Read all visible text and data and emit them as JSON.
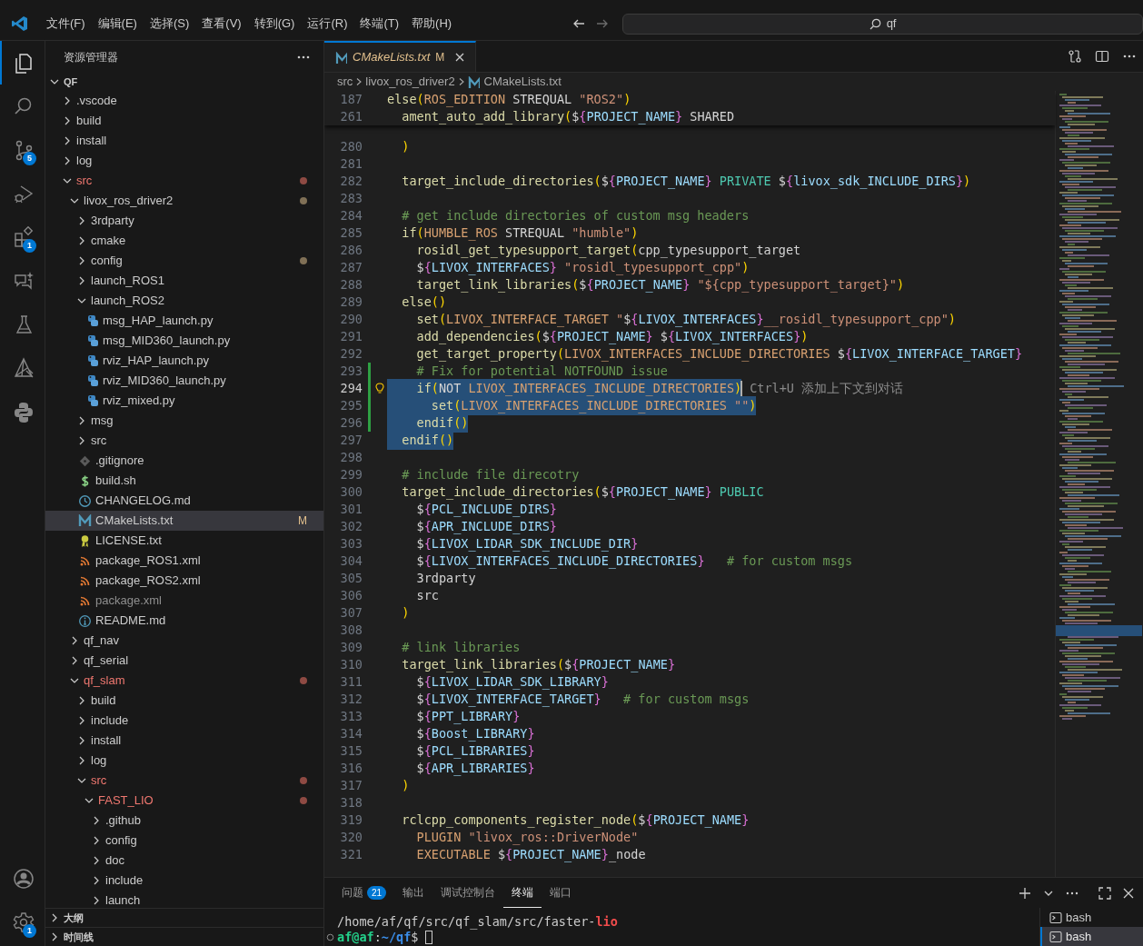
{
  "title_bar": {
    "menus": [
      "文件(F)",
      "编辑(E)",
      "选择(S)",
      "查看(V)",
      "转到(G)",
      "运行(R)",
      "终端(T)",
      "帮助(H)"
    ],
    "command_center": {
      "label": "qf"
    }
  },
  "activity_bar": {
    "top": [
      {
        "kind": "files",
        "selected": true
      },
      {
        "kind": "search",
        "selected": false
      },
      {
        "kind": "source_control",
        "selected": false,
        "badge": "5"
      },
      {
        "kind": "debug",
        "selected": false
      },
      {
        "kind": "extensions",
        "selected": false,
        "badge": "1"
      },
      {
        "kind": "chat",
        "selected": false
      },
      {
        "kind": "testing",
        "selected": false
      },
      {
        "kind": "cmake",
        "selected": false
      },
      {
        "kind": "python",
        "selected": false
      }
    ],
    "bottom": [
      {
        "kind": "account",
        "selected": false
      },
      {
        "kind": "settings",
        "selected": false,
        "badge": "1"
      }
    ]
  },
  "sidebar": {
    "title": "资源管理器",
    "root": {
      "label": "QF",
      "expanded": true
    },
    "tree": [
      {
        "label": ".vscode",
        "kind": "folder",
        "expanded": false,
        "selected": false,
        "problems": false,
        "changed": false,
        "ignored": false
      },
      {
        "label": "build",
        "kind": "folder",
        "expanded": false,
        "selected": false,
        "problems": false,
        "changed": false,
        "ignored": false
      },
      {
        "label": "install",
        "kind": "folder",
        "expanded": false,
        "selected": false,
        "problems": false,
        "changed": false,
        "ignored": false
      },
      {
        "label": "log",
        "kind": "folder",
        "expanded": false,
        "selected": false,
        "problems": false,
        "changed": false,
        "ignored": false
      },
      {
        "label": "src",
        "kind": "folder",
        "expanded": true,
        "selected": false,
        "problems": true,
        "changed": false,
        "ignored": false,
        "children": [
          {
            "label": "livox_ros_driver2",
            "kind": "folder",
            "expanded": true,
            "selected": false,
            "problems": false,
            "changed": true,
            "ignored": false,
            "children": [
              {
                "label": "3rdparty",
                "kind": "folder",
                "expanded": false,
                "selected": false,
                "problems": false,
                "changed": false,
                "ignored": false
              },
              {
                "label": "cmake",
                "kind": "folder",
                "expanded": false,
                "selected": false,
                "problems": false,
                "changed": false,
                "ignored": false
              },
              {
                "label": "config",
                "kind": "folder",
                "expanded": false,
                "selected": false,
                "problems": false,
                "changed": true,
                "ignored": false
              },
              {
                "label": "launch_ROS1",
                "kind": "folder",
                "expanded": false,
                "selected": false,
                "problems": false,
                "changed": false,
                "ignored": false
              },
              {
                "label": "launch_ROS2",
                "kind": "folder",
                "expanded": true,
                "selected": false,
                "problems": false,
                "changed": false,
                "ignored": false,
                "children": [
                  {
                    "label": "msg_HAP_launch.py",
                    "kind": "python",
                    "selected": false,
                    "problems": false,
                    "changed": false,
                    "ignored": false
                  },
                  {
                    "label": "msg_MID360_launch.py",
                    "kind": "python",
                    "selected": false,
                    "problems": false,
                    "changed": false,
                    "ignored": false
                  },
                  {
                    "label": "rviz_HAP_launch.py",
                    "kind": "python",
                    "selected": false,
                    "problems": false,
                    "changed": false,
                    "ignored": false
                  },
                  {
                    "label": "rviz_MID360_launch.py",
                    "kind": "python",
                    "selected": false,
                    "problems": false,
                    "changed": false,
                    "ignored": false
                  },
                  {
                    "label": "rviz_mixed.py",
                    "kind": "python",
                    "selected": false,
                    "problems": false,
                    "changed": false,
                    "ignored": false
                  }
                ]
              },
              {
                "label": "msg",
                "kind": "folder",
                "expanded": false,
                "selected": false,
                "problems": false,
                "changed": false,
                "ignored": false
              },
              {
                "label": "src",
                "kind": "folder",
                "expanded": false,
                "selected": false,
                "problems": false,
                "changed": false,
                "ignored": false
              },
              {
                "label": ".gitignore",
                "kind": "git",
                "selected": false,
                "problems": false,
                "changed": false,
                "ignored": false
              },
              {
                "label": "build.sh",
                "kind": "shell",
                "selected": false,
                "problems": false,
                "changed": false,
                "ignored": false
              },
              {
                "label": "CHANGELOG.md",
                "kind": "history",
                "selected": false,
                "problems": false,
                "changed": false,
                "ignored": false
              },
              {
                "label": "CMakeLists.txt",
                "kind": "cmake",
                "selected": true,
                "problems": false,
                "changed": false,
                "ignored": false,
                "badge": "M"
              },
              {
                "label": "LICENSE.txt",
                "kind": "license",
                "selected": false,
                "problems": false,
                "changed": false,
                "ignored": false
              },
              {
                "label": "package_ROS1.xml",
                "kind": "feed",
                "selected": false,
                "problems": false,
                "changed": false,
                "ignored": false
              },
              {
                "label": "package_ROS2.xml",
                "kind": "feed",
                "selected": false,
                "problems": false,
                "changed": false,
                "ignored": false
              },
              {
                "label": "package.xml",
                "kind": "feed",
                "selected": false,
                "problems": false,
                "changed": false,
                "ignored": true
              },
              {
                "label": "README.md",
                "kind": "info",
                "selected": false,
                "problems": false,
                "changed": false,
                "ignored": false
              }
            ]
          },
          {
            "label": "qf_nav",
            "kind": "folder",
            "expanded": false,
            "selected": false,
            "problems": false,
            "changed": false,
            "ignored": false
          },
          {
            "label": "qf_serial",
            "kind": "folder",
            "expanded": false,
            "selected": false,
            "problems": false,
            "changed": false,
            "ignored": false
          },
          {
            "label": "qf_slam",
            "kind": "folder",
            "expanded": true,
            "selected": false,
            "problems": true,
            "changed": false,
            "ignored": false,
            "children": [
              {
                "label": "build",
                "kind": "folder",
                "expanded": false,
                "selected": false,
                "problems": false,
                "changed": false,
                "ignored": false
              },
              {
                "label": "include",
                "kind": "folder",
                "expanded": false,
                "selected": false,
                "problems": false,
                "changed": false,
                "ignored": false
              },
              {
                "label": "install",
                "kind": "folder",
                "expanded": false,
                "selected": false,
                "problems": false,
                "changed": false,
                "ignored": false
              },
              {
                "label": "log",
                "kind": "folder",
                "expanded": false,
                "selected": false,
                "problems": false,
                "changed": false,
                "ignored": false
              },
              {
                "label": "src",
                "kind": "folder",
                "expanded": true,
                "selected": false,
                "problems": true,
                "changed": false,
                "ignored": false,
                "children": [
                  {
                    "label": "FAST_LIO",
                    "kind": "folder",
                    "expanded": true,
                    "selected": false,
                    "problems": true,
                    "changed": false,
                    "ignored": false,
                    "children": [
                      {
                        "label": ".github",
                        "kind": "folder",
                        "expanded": false,
                        "selected": false,
                        "problems": false,
                        "changed": false,
                        "ignored": false
                      },
                      {
                        "label": "config",
                        "kind": "folder",
                        "expanded": false,
                        "selected": false,
                        "problems": false,
                        "changed": false,
                        "ignored": false
                      },
                      {
                        "label": "doc",
                        "kind": "folder",
                        "expanded": false,
                        "selected": false,
                        "problems": false,
                        "changed": false,
                        "ignored": false
                      },
                      {
                        "label": "include",
                        "kind": "folder",
                        "expanded": false,
                        "selected": false,
                        "problems": false,
                        "changed": false,
                        "ignored": false
                      },
                      {
                        "label": "launch",
                        "kind": "folder",
                        "expanded": false,
                        "selected": false,
                        "problems": false,
                        "changed": false,
                        "ignored": false
                      }
                    ]
                  }
                ]
              }
            ]
          }
        ]
      }
    ],
    "sections": [
      {
        "label": "大纲",
        "expanded": false
      },
      {
        "label": "时间线",
        "expanded": false
      }
    ]
  },
  "editor": {
    "tabs": [
      {
        "label": "CMakeLists.txt",
        "badge": "M",
        "selected": true,
        "preview": true
      }
    ],
    "breadcrumbs": [
      {
        "label": "src",
        "kind": "folder"
      },
      {
        "label": "livox_ros_driver2",
        "kind": "folder"
      },
      {
        "label": "CMakeLists.txt",
        "kind": "cmake"
      }
    ],
    "sticky_lines": [
      {
        "number": "187",
        "tokens": [
          {
            "text": "else",
            "kind": "function"
          },
          {
            "text": "(",
            "kind": "paren"
          },
          {
            "text": "ROS_EDITION",
            "kind": "constant"
          },
          {
            "text": " STREQUAL ",
            "kind": "plain"
          },
          {
            "text": "\"ROS2\"",
            "kind": "string"
          },
          {
            "text": ")",
            "kind": "paren"
          }
        ]
      },
      {
        "number": "261",
        "tokens": [
          {
            "text": "  ament_auto_add_library",
            "kind": "function"
          },
          {
            "text": "(",
            "kind": "paren"
          },
          {
            "text": "$",
            "kind": "plain"
          },
          {
            "text": "{",
            "kind": "brace"
          },
          {
            "text": "PROJECT_NAME",
            "kind": "variable"
          },
          {
            "text": "}",
            "kind": "brace"
          },
          {
            "text": " SHARED",
            "kind": "plain"
          }
        ]
      }
    ],
    "lines": [
      {
        "number": "280",
        "current": false,
        "selected": false,
        "changed": false,
        "tokens": [
          {
            "text": "  )",
            "kind": "paren"
          }
        ]
      },
      {
        "number": "281",
        "current": false,
        "selected": false,
        "changed": false
      },
      {
        "number": "282",
        "current": false,
        "selected": false,
        "changed": false,
        "tokens": [
          {
            "text": "  target_include_directories",
            "kind": "function"
          },
          {
            "text": "(",
            "kind": "paren"
          },
          {
            "text": "$",
            "kind": "plain"
          },
          {
            "text": "{",
            "kind": "brace"
          },
          {
            "text": "PROJECT_NAME",
            "kind": "variable"
          },
          {
            "text": "}",
            "kind": "brace"
          },
          {
            "text": " PRIVATE",
            "kind": "keyword"
          },
          {
            "text": " $",
            "kind": "plain"
          },
          {
            "text": "{",
            "kind": "brace"
          },
          {
            "text": "livox_sdk_INCLUDE_DIRS",
            "kind": "variable"
          },
          {
            "text": "}",
            "kind": "brace"
          },
          {
            "text": ")",
            "kind": "paren"
          }
        ]
      },
      {
        "number": "283",
        "current": false,
        "selected": false,
        "changed": false
      },
      {
        "number": "284",
        "current": false,
        "selected": false,
        "changed": false,
        "tokens": [
          {
            "text": "  # get include directories of custom msg headers",
            "kind": "comment"
          }
        ]
      },
      {
        "number": "285",
        "current": false,
        "selected": false,
        "changed": false,
        "tokens": [
          {
            "text": "  if",
            "kind": "function"
          },
          {
            "text": "(",
            "kind": "paren"
          },
          {
            "text": "HUMBLE_ROS",
            "kind": "constant"
          },
          {
            "text": " STREQUAL ",
            "kind": "plain"
          },
          {
            "text": "\"humble\"",
            "kind": "string"
          },
          {
            "text": ")",
            "kind": "paren"
          }
        ]
      },
      {
        "number": "286",
        "current": false,
        "selected": false,
        "changed": false,
        "tokens": [
          {
            "text": "    rosidl_get_typesupport_target",
            "kind": "function"
          },
          {
            "text": "(",
            "kind": "paren"
          },
          {
            "text": "cpp_typesupport_target",
            "kind": "plain"
          }
        ]
      },
      {
        "number": "287",
        "current": false,
        "selected": false,
        "changed": false,
        "tokens": [
          {
            "text": "    $",
            "kind": "plain"
          },
          {
            "text": "{",
            "kind": "brace"
          },
          {
            "text": "LIVOX_INTERFACES",
            "kind": "variable"
          },
          {
            "text": "}",
            "kind": "brace"
          },
          {
            "text": " \"rosidl_typesupport_cpp\"",
            "kind": "string"
          },
          {
            "text": ")",
            "kind": "paren"
          }
        ]
      },
      {
        "number": "288",
        "current": false,
        "selected": false,
        "changed": false,
        "tokens": [
          {
            "text": "    target_link_libraries",
            "kind": "function"
          },
          {
            "text": "(",
            "kind": "paren"
          },
          {
            "text": "$",
            "kind": "plain"
          },
          {
            "text": "{",
            "kind": "brace"
          },
          {
            "text": "PROJECT_NAME",
            "kind": "variable"
          },
          {
            "text": "}",
            "kind": "brace"
          },
          {
            "text": " \"${cpp_typesupport_target}\"",
            "kind": "string"
          },
          {
            "text": ")",
            "kind": "paren"
          }
        ]
      },
      {
        "number": "289",
        "current": false,
        "selected": false,
        "changed": false,
        "tokens": [
          {
            "text": "  else",
            "kind": "function"
          },
          {
            "text": "()",
            "kind": "paren"
          }
        ]
      },
      {
        "number": "290",
        "current": false,
        "selected": false,
        "changed": false,
        "tokens": [
          {
            "text": "    set",
            "kind": "function"
          },
          {
            "text": "(",
            "kind": "paren"
          },
          {
            "text": "LIVOX_INTERFACE_TARGET",
            "kind": "constant"
          },
          {
            "text": " \"",
            "kind": "string"
          },
          {
            "text": "$",
            "kind": "plain"
          },
          {
            "text": "{",
            "kind": "brace"
          },
          {
            "text": "LIVOX_INTERFACES",
            "kind": "variable"
          },
          {
            "text": "}",
            "kind": "brace"
          },
          {
            "text": "__rosidl_typesupport_cpp\"",
            "kind": "string"
          },
          {
            "text": ")",
            "kind": "paren"
          }
        ]
      },
      {
        "number": "291",
        "current": false,
        "selected": false,
        "changed": false,
        "tokens": [
          {
            "text": "    add_dependencies",
            "kind": "function"
          },
          {
            "text": "(",
            "kind": "paren"
          },
          {
            "text": "$",
            "kind": "plain"
          },
          {
            "text": "{",
            "kind": "brace"
          },
          {
            "text": "PROJECT_NAME",
            "kind": "variable"
          },
          {
            "text": "}",
            "kind": "brace"
          },
          {
            "text": " $",
            "kind": "plain"
          },
          {
            "text": "{",
            "kind": "brace"
          },
          {
            "text": "LIVOX_INTERFACES",
            "kind": "variable"
          },
          {
            "text": "}",
            "kind": "brace"
          },
          {
            "text": ")",
            "kind": "paren"
          }
        ]
      },
      {
        "number": "292",
        "current": false,
        "selected": false,
        "changed": false,
        "tokens": [
          {
            "text": "    get_target_property",
            "kind": "function"
          },
          {
            "text": "(",
            "kind": "paren"
          },
          {
            "text": "LIVOX_INTERFACES_INCLUDE_DIRECTORIES",
            "kind": "constant"
          },
          {
            "text": " $",
            "kind": "plain"
          },
          {
            "text": "{",
            "kind": "brace"
          },
          {
            "text": "LIVOX_INTERFACE_TARGET",
            "kind": "variable"
          },
          {
            "text": "}",
            "kind": "brace"
          }
        ]
      },
      {
        "number": "293",
        "current": false,
        "selected": false,
        "changed": true,
        "tokens": [
          {
            "text": "    # Fix for potential NOTFOUND issue",
            "kind": "comment"
          }
        ]
      },
      {
        "number": "294",
        "current": true,
        "selected": true,
        "changed": true,
        "hint": "Ctrl+U 添加上下文到对话",
        "tokens": [
          {
            "text": "    if",
            "kind": "function"
          },
          {
            "text": "(",
            "kind": "paren"
          },
          {
            "text": "NOT ",
            "kind": "plain"
          },
          {
            "text": "LIVOX_INTERFACES_INCLUDE_DIRECTORIES",
            "kind": "constant"
          },
          {
            "text": ")",
            "kind": "paren"
          }
        ]
      },
      {
        "number": "295",
        "current": false,
        "selected": true,
        "changed": true,
        "tokens": [
          {
            "text": "      set",
            "kind": "function"
          },
          {
            "text": "(",
            "kind": "paren"
          },
          {
            "text": "LIVOX_INTERFACES_INCLUDE_DIRECTORIES",
            "kind": "constant"
          },
          {
            "text": " \"\"",
            "kind": "string"
          },
          {
            "text": ")",
            "kind": "paren"
          }
        ]
      },
      {
        "number": "296",
        "current": false,
        "selected": true,
        "changed": true,
        "tokens": [
          {
            "text": "    endif",
            "kind": "function"
          },
          {
            "text": "()",
            "kind": "paren"
          }
        ]
      },
      {
        "number": "297",
        "current": false,
        "selected": true,
        "changed": false,
        "tokens": [
          {
            "text": "  endif",
            "kind": "function"
          },
          {
            "text": "()",
            "kind": "paren"
          }
        ]
      },
      {
        "number": "298",
        "current": false,
        "selected": false,
        "changed": false
      },
      {
        "number": "299",
        "current": false,
        "selected": false,
        "changed": false,
        "tokens": [
          {
            "text": "  # include file direcotry",
            "kind": "comment"
          }
        ]
      },
      {
        "number": "300",
        "current": false,
        "selected": false,
        "changed": false,
        "tokens": [
          {
            "text": "  target_include_directories",
            "kind": "function"
          },
          {
            "text": "(",
            "kind": "paren"
          },
          {
            "text": "$",
            "kind": "plain"
          },
          {
            "text": "{",
            "kind": "brace"
          },
          {
            "text": "PROJECT_NAME",
            "kind": "variable"
          },
          {
            "text": "}",
            "kind": "brace"
          },
          {
            "text": " PUBLIC",
            "kind": "keyword"
          }
        ]
      },
      {
        "number": "301",
        "current": false,
        "selected": false,
        "changed": false,
        "tokens": [
          {
            "text": "    $",
            "kind": "plain"
          },
          {
            "text": "{",
            "kind": "brace"
          },
          {
            "text": "PCL_INCLUDE_DIRS",
            "kind": "variable"
          },
          {
            "text": "}",
            "kind": "brace"
          }
        ]
      },
      {
        "number": "302",
        "current": false,
        "selected": false,
        "changed": false,
        "tokens": [
          {
            "text": "    $",
            "kind": "plain"
          },
          {
            "text": "{",
            "kind": "brace"
          },
          {
            "text": "APR_INCLUDE_DIRS",
            "kind": "variable"
          },
          {
            "text": "}",
            "kind": "brace"
          }
        ]
      },
      {
        "number": "303",
        "current": false,
        "selected": false,
        "changed": false,
        "tokens": [
          {
            "text": "    $",
            "kind": "plain"
          },
          {
            "text": "{",
            "kind": "brace"
          },
          {
            "text": "LIVOX_LIDAR_SDK_INCLUDE_DIR",
            "kind": "variable"
          },
          {
            "text": "}",
            "kind": "brace"
          }
        ]
      },
      {
        "number": "304",
        "current": false,
        "selected": false,
        "changed": false,
        "tokens": [
          {
            "text": "    $",
            "kind": "plain"
          },
          {
            "text": "{",
            "kind": "brace"
          },
          {
            "text": "LIVOX_INTERFACES_INCLUDE_DIRECTORIES",
            "kind": "variable"
          },
          {
            "text": "}",
            "kind": "brace"
          },
          {
            "text": "   # for custom msgs",
            "kind": "comment"
          }
        ]
      },
      {
        "number": "305",
        "current": false,
        "selected": false,
        "changed": false,
        "tokens": [
          {
            "text": "    3rdparty",
            "kind": "plain"
          }
        ]
      },
      {
        "number": "306",
        "current": false,
        "selected": false,
        "changed": false,
        "tokens": [
          {
            "text": "    src",
            "kind": "plain"
          }
        ]
      },
      {
        "number": "307",
        "current": false,
        "selected": false,
        "changed": false,
        "tokens": [
          {
            "text": "  )",
            "kind": "paren"
          }
        ]
      },
      {
        "number": "308",
        "current": false,
        "selected": false,
        "changed": false
      },
      {
        "number": "309",
        "current": false,
        "selected": false,
        "changed": false,
        "tokens": [
          {
            "text": "  # link libraries",
            "kind": "comment"
          }
        ]
      },
      {
        "number": "310",
        "current": false,
        "selected": false,
        "changed": false,
        "tokens": [
          {
            "text": "  target_link_libraries",
            "kind": "function"
          },
          {
            "text": "(",
            "kind": "paren"
          },
          {
            "text": "$",
            "kind": "plain"
          },
          {
            "text": "{",
            "kind": "brace"
          },
          {
            "text": "PROJECT_NAME",
            "kind": "variable"
          },
          {
            "text": "}",
            "kind": "brace"
          }
        ]
      },
      {
        "number": "311",
        "current": false,
        "selected": false,
        "changed": false,
        "tokens": [
          {
            "text": "    $",
            "kind": "plain"
          },
          {
            "text": "{",
            "kind": "brace"
          },
          {
            "text": "LIVOX_LIDAR_SDK_LIBRARY",
            "kind": "variable"
          },
          {
            "text": "}",
            "kind": "brace"
          }
        ]
      },
      {
        "number": "312",
        "current": false,
        "selected": false,
        "changed": false,
        "tokens": [
          {
            "text": "    $",
            "kind": "plain"
          },
          {
            "text": "{",
            "kind": "brace"
          },
          {
            "text": "LIVOX_INTERFACE_TARGET",
            "kind": "variable"
          },
          {
            "text": "}",
            "kind": "brace"
          },
          {
            "text": "   # for custom msgs",
            "kind": "comment"
          }
        ]
      },
      {
        "number": "313",
        "current": false,
        "selected": false,
        "changed": false,
        "tokens": [
          {
            "text": "    $",
            "kind": "plain"
          },
          {
            "text": "{",
            "kind": "brace"
          },
          {
            "text": "PPT_LIBRARY",
            "kind": "variable"
          },
          {
            "text": "}",
            "kind": "brace"
          }
        ]
      },
      {
        "number": "314",
        "current": false,
        "selected": false,
        "changed": false,
        "tokens": [
          {
            "text": "    $",
            "kind": "plain"
          },
          {
            "text": "{",
            "kind": "brace"
          },
          {
            "text": "Boost_LIBRARY",
            "kind": "variable"
          },
          {
            "text": "}",
            "kind": "brace"
          }
        ]
      },
      {
        "number": "315",
        "current": false,
        "selected": false,
        "changed": false,
        "tokens": [
          {
            "text": "    $",
            "kind": "plain"
          },
          {
            "text": "{",
            "kind": "brace"
          },
          {
            "text": "PCL_LIBRARIES",
            "kind": "variable"
          },
          {
            "text": "}",
            "kind": "brace"
          }
        ]
      },
      {
        "number": "316",
        "current": false,
        "selected": false,
        "changed": false,
        "tokens": [
          {
            "text": "    $",
            "kind": "plain"
          },
          {
            "text": "{",
            "kind": "brace"
          },
          {
            "text": "APR_LIBRARIES",
            "kind": "variable"
          },
          {
            "text": "}",
            "kind": "brace"
          }
        ]
      },
      {
        "number": "317",
        "current": false,
        "selected": false,
        "changed": false,
        "tokens": [
          {
            "text": "  )",
            "kind": "paren"
          }
        ]
      },
      {
        "number": "318",
        "current": false,
        "selected": false,
        "changed": false
      },
      {
        "number": "319",
        "current": false,
        "selected": false,
        "changed": false,
        "tokens": [
          {
            "text": "  rclcpp_components_register_node",
            "kind": "function"
          },
          {
            "text": "(",
            "kind": "paren"
          },
          {
            "text": "$",
            "kind": "plain"
          },
          {
            "text": "{",
            "kind": "brace"
          },
          {
            "text": "PROJECT_NAME",
            "kind": "variable"
          },
          {
            "text": "}",
            "kind": "brace"
          }
        ]
      },
      {
        "number": "320",
        "current": false,
        "selected": false,
        "changed": false,
        "tokens": [
          {
            "text": "    PLUGIN ",
            "kind": "constant"
          },
          {
            "text": "\"livox_ros::DriverNode\"",
            "kind": "string"
          }
        ]
      },
      {
        "number": "321",
        "current": false,
        "selected": false,
        "changed": false,
        "tokens": [
          {
            "text": "    EXECUTABLE ",
            "kind": "constant"
          },
          {
            "text": "$",
            "kind": "plain"
          },
          {
            "text": "{",
            "kind": "brace"
          },
          {
            "text": "PROJECT_NAME",
            "kind": "variable"
          },
          {
            "text": "}",
            "kind": "brace"
          },
          {
            "text": "_node",
            "kind": "plain"
          }
        ]
      }
    ]
  },
  "panel": {
    "tabs": [
      {
        "label": "问题",
        "badge": "21",
        "selected": false
      },
      {
        "label": "输出",
        "selected": false
      },
      {
        "label": "调试控制台",
        "selected": false
      },
      {
        "label": "终端",
        "selected": true
      },
      {
        "label": "端口",
        "selected": false
      }
    ],
    "terminal_lines": [
      {
        "prompt": false,
        "segments": [
          {
            "text": "/home/af/qf/src/qf_slam/src/faster-",
            "kind": "plain"
          },
          {
            "text": "lio",
            "kind": "match"
          }
        ]
      },
      {
        "prompt": true,
        "segments": [
          {
            "text": "af@af",
            "kind": "user"
          },
          {
            "text": ":",
            "kind": "plain"
          },
          {
            "text": "~/qf",
            "kind": "path"
          },
          {
            "text": "$",
            "kind": "plain"
          }
        ]
      }
    ],
    "terminals": [
      {
        "label": "bash",
        "selected": false
      },
      {
        "label": "bash",
        "selected": true
      }
    ]
  }
}
